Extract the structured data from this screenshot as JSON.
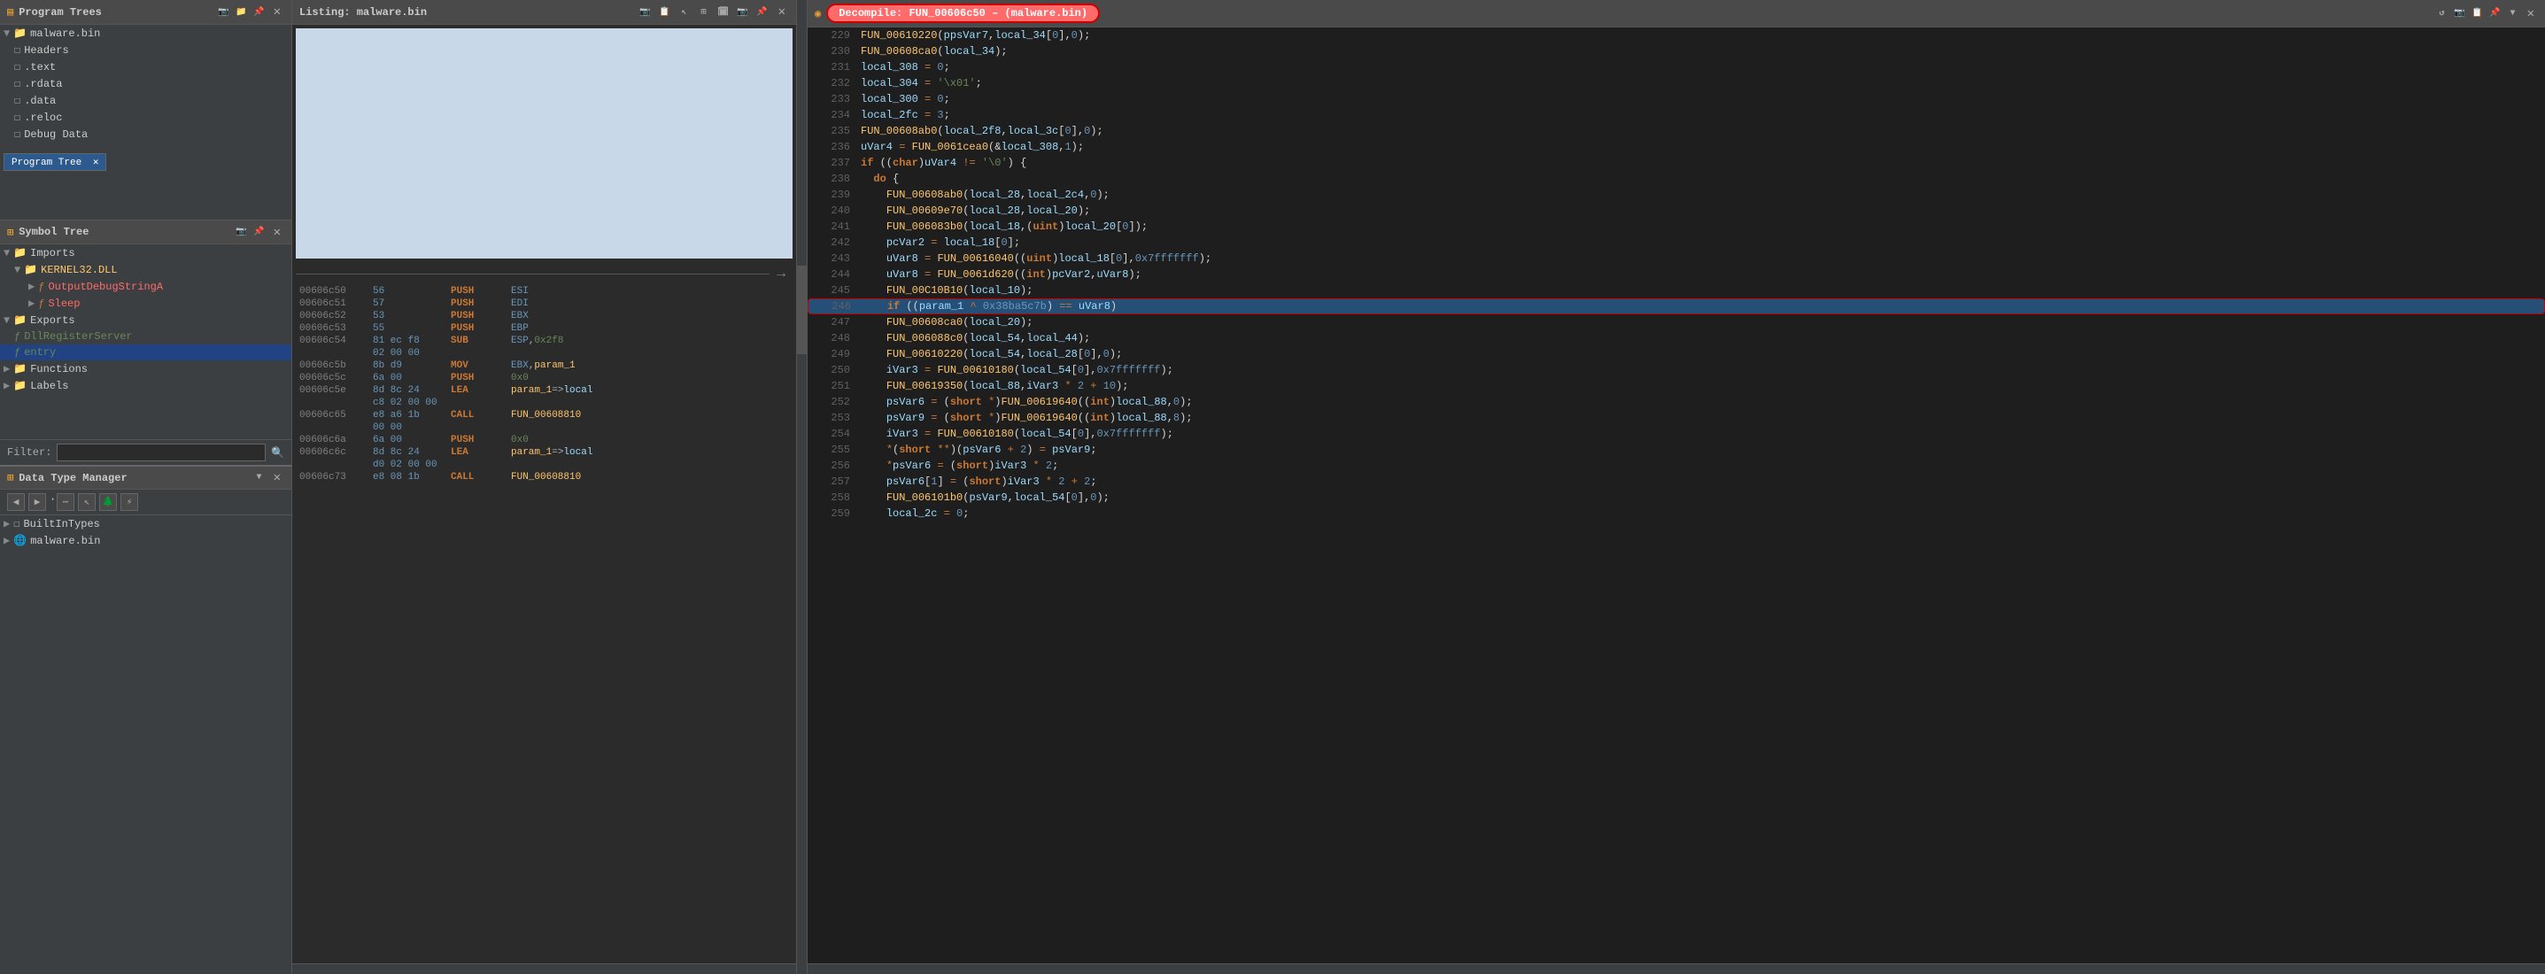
{
  "panels": {
    "program_trees": {
      "title": "Program Trees",
      "items": [
        {
          "id": "malware_bin",
          "label": "malware.bin",
          "type": "folder",
          "level": 0,
          "expanded": true
        },
        {
          "id": "headers",
          "label": "Headers",
          "type": "file",
          "level": 1
        },
        {
          "id": "text",
          "label": ".text",
          "type": "file",
          "level": 1
        },
        {
          "id": "rdata",
          "label": ".rdata",
          "type": "file",
          "level": 1
        },
        {
          "id": "data",
          "label": ".data",
          "type": "file",
          "level": 1
        },
        {
          "id": "reloc",
          "label": ".reloc",
          "type": "file",
          "level": 1
        },
        {
          "id": "debug_data",
          "label": "Debug Data",
          "type": "file",
          "level": 1
        }
      ],
      "tab_label": "Program Tree"
    },
    "symbol_tree": {
      "title": "Symbol Tree",
      "items": [
        {
          "id": "imports",
          "label": "Imports",
          "type": "folder",
          "level": 0,
          "expanded": true
        },
        {
          "id": "kernel32",
          "label": "KERNEL32.DLL",
          "type": "folder",
          "level": 1,
          "expanded": true
        },
        {
          "id": "outputdebug",
          "label": "OutputDebugStringA",
          "type": "func",
          "level": 2,
          "color": "red"
        },
        {
          "id": "sleep",
          "label": "Sleep",
          "type": "func",
          "level": 2,
          "color": "red"
        },
        {
          "id": "exports",
          "label": "Exports",
          "type": "folder",
          "level": 0,
          "expanded": true
        },
        {
          "id": "dllregister",
          "label": "DllRegisterServer",
          "type": "export",
          "level": 1,
          "color": "green"
        },
        {
          "id": "entry",
          "label": "entry",
          "type": "export",
          "level": 1,
          "color": "green",
          "selected": true
        },
        {
          "id": "functions",
          "label": "Functions",
          "type": "folder",
          "level": 0
        },
        {
          "id": "labels",
          "label": "Labels",
          "type": "folder",
          "level": 0
        }
      ],
      "filter_label": "Filter:",
      "filter_placeholder": ""
    },
    "data_type_manager": {
      "title": "Data Type Manager",
      "items": [
        {
          "id": "built_in",
          "label": "BuiltInTypes",
          "type": "folder",
          "level": 0
        },
        {
          "id": "malware_bin_dt",
          "label": "malware.bin",
          "type": "folder",
          "level": 0
        }
      ]
    },
    "listing": {
      "title": "Listing:  malware.bin",
      "rows": [
        {
          "addr": "00606c50",
          "hex": "56",
          "mnemonic": "PUSH",
          "operand": "ESI"
        },
        {
          "addr": "00606c51",
          "hex": "57",
          "mnemonic": "PUSH",
          "operand": "EDI"
        },
        {
          "addr": "00606c52",
          "hex": "53",
          "mnemonic": "PUSH",
          "operand": "EBX"
        },
        {
          "addr": "00606c53",
          "hex": "55",
          "mnemonic": "PUSH",
          "operand": "EBP"
        },
        {
          "addr": "00606c54",
          "hex": "81 ec f8",
          "mnemonic": "SUB",
          "operand": "ESP,0x2f8"
        },
        {
          "addr": "",
          "hex": "02 00 00",
          "mnemonic": "",
          "operand": ""
        },
        {
          "addr": "00606c5b",
          "hex": "8b d9",
          "mnemonic": "MOV",
          "operand": "EBX,param_1"
        },
        {
          "addr": "00606c5c",
          "hex": "6a 00",
          "mnemonic": "PUSH",
          "operand": "0x0"
        },
        {
          "addr": "00606c5e",
          "hex": "8d 8c 24",
          "mnemonic": "LEA",
          "operand": "param_1=>local"
        },
        {
          "addr": "",
          "hex": "c8 02 00 00",
          "mnemonic": "",
          "operand": ""
        },
        {
          "addr": "00606c65",
          "hex": "e8 a6 1b",
          "mnemonic": "CALL",
          "operand": "FUN_00608810"
        },
        {
          "addr": "",
          "hex": "00 00",
          "mnemonic": "",
          "operand": ""
        },
        {
          "addr": "00606c6a",
          "hex": "6a 00",
          "mnemonic": "PUSH",
          "operand": "0x0"
        },
        {
          "addr": "00606c6c",
          "hex": "8d 8c 24",
          "mnemonic": "LEA",
          "operand": "param_1=>local"
        },
        {
          "addr": "",
          "hex": "d0 02 00 00",
          "mnemonic": "",
          "operand": ""
        },
        {
          "addr": "00606c73",
          "hex": "e8 08 1b",
          "mnemonic": "CALL",
          "operand": "FUN_00608810"
        }
      ]
    },
    "decompile": {
      "title": "Decompile: FUN_00606c50 – (malware.bin)",
      "lines": [
        {
          "num": "229",
          "text": "FUN_00610220(ppsVar7,local_34[0],0);"
        },
        {
          "num": "230",
          "text": "FUN_00608ca0(local_34);"
        },
        {
          "num": "231",
          "text": "local_308 = 0;"
        },
        {
          "num": "232",
          "text": "local_304 = '\\x01';"
        },
        {
          "num": "233",
          "text": "local_300 = 0;"
        },
        {
          "num": "234",
          "text": "local_2fc = 3;"
        },
        {
          "num": "235",
          "text": "FUN_00608ab0(local_2f8,local_3c[0],0);"
        },
        {
          "num": "236",
          "text": "uVar4 = FUN_0061cea0(&local_308,1);"
        },
        {
          "num": "237",
          "text": "if ((char)uVar4 != '\\0') {"
        },
        {
          "num": "238",
          "text": "do {"
        },
        {
          "num": "239",
          "text": "FUN_00608ab0(local_28,local_2c4,0);"
        },
        {
          "num": "240",
          "text": "FUN_00609e70(local_28,local_20);"
        },
        {
          "num": "241",
          "text": "FUN_006083b0(local_18,(uint)local_20[0]);"
        },
        {
          "num": "242",
          "text": "pcVar2 = local_18[0];"
        },
        {
          "num": "243",
          "text": "uVar8 = FUN_00616040((uint)local_18[0],0x7fffffff);"
        },
        {
          "num": "244",
          "text": "uVar8 = FUN_0061d620((int)pcVar2,uVar8);"
        },
        {
          "num": "245",
          "text": "FUN_00C10B10(local_10);"
        },
        {
          "num": "246",
          "text": "if ((param_1 ^ 0x38ba5c7b) == uVar8)",
          "highlighted": true
        },
        {
          "num": "247",
          "text": "FUN_00608ca0(local_20);"
        },
        {
          "num": "248",
          "text": "FUN_006088c0(local_54,local_44);"
        },
        {
          "num": "249",
          "text": "FUN_00610220(local_54,local_28[0],0);"
        },
        {
          "num": "250",
          "text": "iVar3 = FUN_00610180(local_54[0],0x7fffffff);"
        },
        {
          "num": "251",
          "text": "FUN_00619350(local_88,iVar3 * 2 + 10);"
        },
        {
          "num": "252",
          "text": "psVar6 = (short *)FUN_00619640((int)local_88,0);"
        },
        {
          "num": "253",
          "text": "psVar9 = (short *)FUN_00619640((int)local_88,8);"
        },
        {
          "num": "254",
          "text": "iVar3 = FUN_00610180(local_54[0],0x7fffffff);"
        },
        {
          "num": "255",
          "text": "*(short **)(psVar6 + 2) = psVar9;"
        },
        {
          "num": "256",
          "text": "*psVar6 = (short)iVar3 * 2;"
        },
        {
          "num": "257",
          "text": "psVar6[1] = (short)iVar3 * 2 + 2;"
        },
        {
          "num": "258",
          "text": "FUN_006101b0(psVar9,local_54[0],0);"
        },
        {
          "num": "259",
          "text": "local_2c = 0;"
        }
      ]
    }
  },
  "icons": {
    "folder": "▶",
    "folder_open": "▼",
    "file": "☐",
    "func": "ƒ",
    "close": "✕",
    "arrow_right": "→",
    "search": "🔍",
    "expand": "▼",
    "collapse": "▶",
    "refresh": "↺",
    "camera": "📷",
    "cursor": "↖",
    "grid": "⊞",
    "pin": "📌",
    "nav_back": "◀",
    "nav_fwd": "▶"
  }
}
